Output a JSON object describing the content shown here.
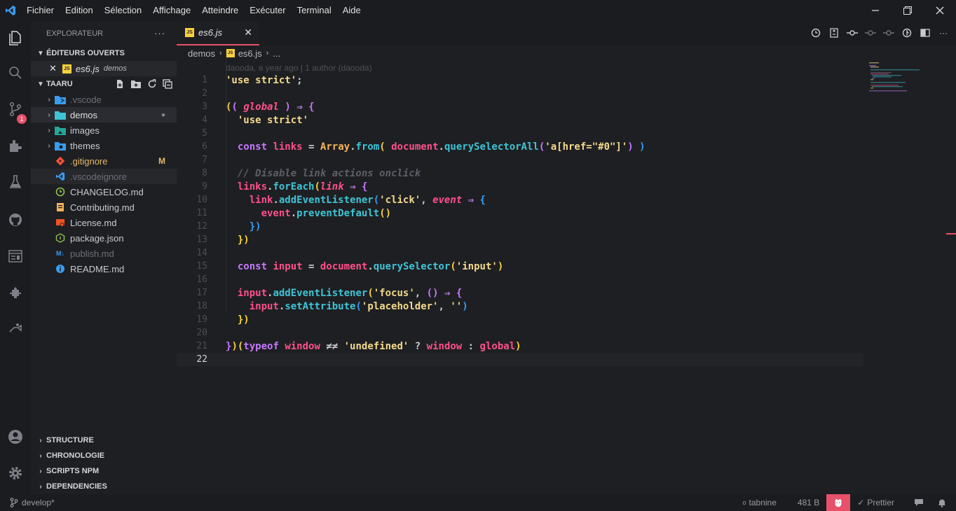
{
  "menu": [
    "Fichier",
    "Edition",
    "Sélection",
    "Affichage",
    "Atteindre",
    "Exécuter",
    "Terminal",
    "Aide"
  ],
  "activity": {
    "scm_badge": "1"
  },
  "sidebar": {
    "title": "EXPLORATEUR",
    "more": "···",
    "open_editors_title": "ÉDITEURS OUVERTS",
    "open_editor": {
      "name": "es6.js",
      "folder": "demos"
    },
    "workspace_title": "TAARU",
    "tree": [
      {
        "label": ".vscode",
        "type": "folder",
        "icon": "vscode-folder-icon",
        "dim": true
      },
      {
        "label": "demos",
        "type": "folder",
        "icon": "folder-icon",
        "selected": true,
        "dot": "●"
      },
      {
        "label": "images",
        "type": "folder",
        "icon": "images-folder-icon"
      },
      {
        "label": "themes",
        "type": "folder",
        "icon": "themes-folder-icon"
      },
      {
        "label": ".gitignore",
        "type": "file",
        "icon": "git-icon",
        "status": "M"
      },
      {
        "label": ".vscodeignore",
        "type": "file",
        "icon": "vscode-icon",
        "dim": true
      },
      {
        "label": "CHANGELOG.md",
        "type": "file",
        "icon": "changelog-icon"
      },
      {
        "label": "Contributing.md",
        "type": "file",
        "icon": "contributing-icon"
      },
      {
        "label": "License.md",
        "type": "file",
        "icon": "license-icon"
      },
      {
        "label": "package.json",
        "type": "file",
        "icon": "node-icon"
      },
      {
        "label": "publish.md",
        "type": "file",
        "icon": "markdown-icon",
        "dim": true
      },
      {
        "label": "README.md",
        "type": "file",
        "icon": "info-icon"
      }
    ],
    "bottom_sections": [
      "STRUCTURE",
      "CHRONOLOGIE",
      "SCRIPTS NPM",
      "DEPENDENCIES"
    ]
  },
  "editor": {
    "tab_title": "es6.js",
    "tab_icon": "JS",
    "breadcrumb": [
      "demos",
      "es6.js",
      "..."
    ],
    "blame": "daooda, a year ago | 1 author (daooda)",
    "current_line": 22,
    "line_numbers": [
      "1",
      "2",
      "3",
      "4",
      "5",
      "6",
      "7",
      "8",
      "9",
      "10",
      "11",
      "12",
      "13",
      "14",
      "15",
      "16",
      "17",
      "18",
      "19",
      "20",
      "21",
      "22"
    ]
  },
  "status": {
    "branch": "develop*",
    "tabnine": "tabnine",
    "size": "481 B",
    "prettier": "Prettier"
  },
  "colors": {
    "accent": "#e7526a",
    "string": "#f2d98c",
    "keyword": "#c678ff",
    "function": "#3ec4d6",
    "variable": "#ff4f8b"
  }
}
